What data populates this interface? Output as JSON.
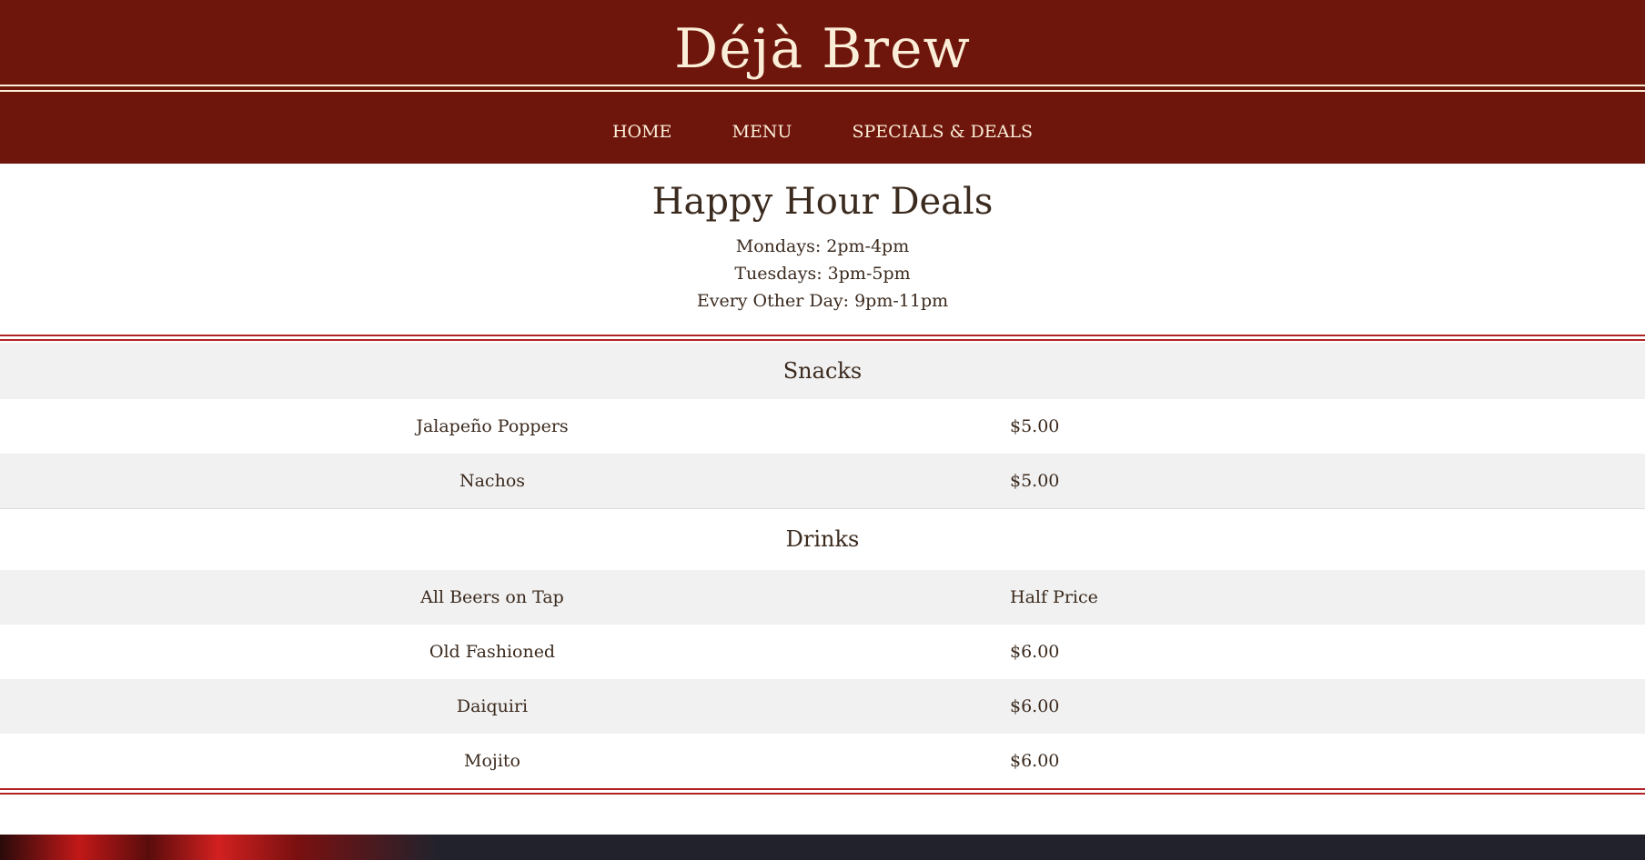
{
  "header": {
    "brand": "Déjà Brew",
    "nav": [
      {
        "label": "HOME"
      },
      {
        "label": "MENU"
      },
      {
        "label": "SPECIALS & DEALS"
      }
    ]
  },
  "intro": {
    "title": "Happy Hour Deals",
    "hours": [
      "Mondays: 2pm-4pm",
      "Tuesdays: 3pm-5pm",
      "Every Other Day: 9pm-11pm"
    ]
  },
  "sections": [
    {
      "title": "Snacks",
      "items": [
        {
          "name": "Jalapeño Poppers",
          "price": "$5.00"
        },
        {
          "name": "Nachos",
          "price": "$5.00"
        }
      ]
    },
    {
      "title": "Drinks",
      "items": [
        {
          "name": "All Beers on Tap",
          "price": "Half Price"
        },
        {
          "name": "Old Fashioned",
          "price": "$6.00"
        },
        {
          "name": "Daiquiri",
          "price": "$6.00"
        },
        {
          "name": "Mojito",
          "price": "$6.00"
        }
      ]
    }
  ],
  "colors": {
    "header_bg": "#6f160c",
    "header_text": "#fbeed8",
    "accent_line": "#b22224",
    "body_text": "#3b2a1e",
    "row_alt": "#f1f1f1"
  }
}
